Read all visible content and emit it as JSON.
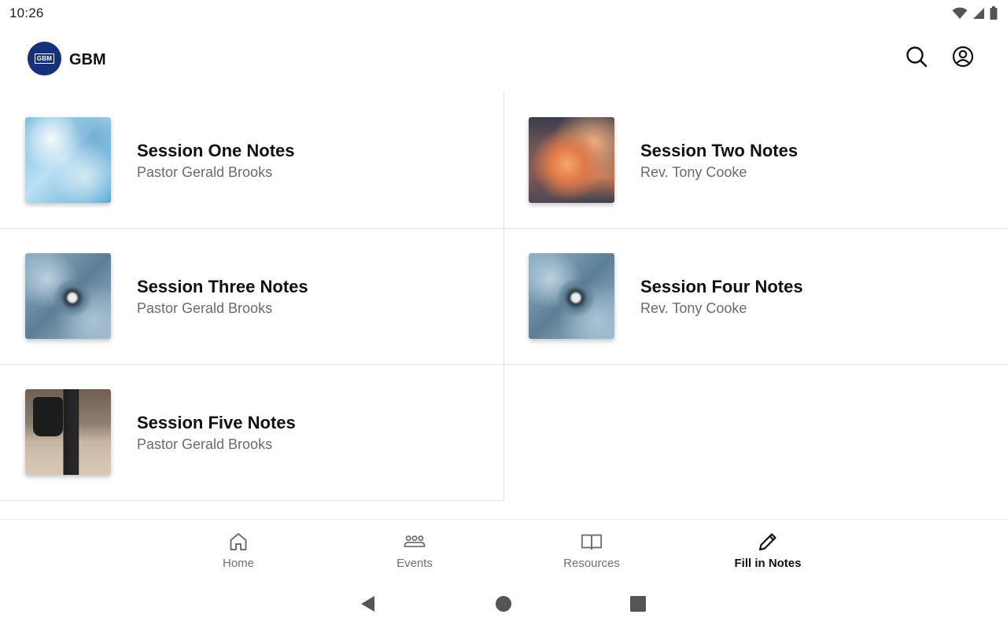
{
  "status_bar": {
    "time": "10:26",
    "icons": [
      "wifi-icon",
      "cell-signal-icon",
      "battery-icon"
    ]
  },
  "app_bar": {
    "logo_text": "GBM",
    "title": "GBM",
    "actions": [
      "search-icon",
      "account-circle-icon"
    ],
    "brand_color": "#14317a"
  },
  "sessions": [
    {
      "title": "Session One Notes",
      "speaker": "Pastor Gerald Brooks",
      "image": "ice-texture"
    },
    {
      "title": "Session Two Notes",
      "speaker": "Rev. Tony Cooke",
      "image": "sunset-clouds"
    },
    {
      "title": "Session Three Notes",
      "speaker": "Pastor Gerald Brooks",
      "image": "succulent"
    },
    {
      "title": "Session Four Notes",
      "speaker": "Rev. Tony Cooke",
      "image": "succulent"
    },
    {
      "title": "Session Five Notes",
      "speaker": "Pastor Gerald Brooks",
      "image": "street-walker"
    }
  ],
  "bottom_nav": {
    "items": [
      {
        "label": "Home",
        "icon": "home-icon",
        "active": false
      },
      {
        "label": "Events",
        "icon": "group-icon",
        "active": false
      },
      {
        "label": "Resources",
        "icon": "book-icon",
        "active": false
      },
      {
        "label": "Fill in Notes",
        "icon": "pencil-icon",
        "active": true
      }
    ]
  },
  "system_nav": [
    "back-icon",
    "home-circle-icon",
    "recents-icon"
  ]
}
